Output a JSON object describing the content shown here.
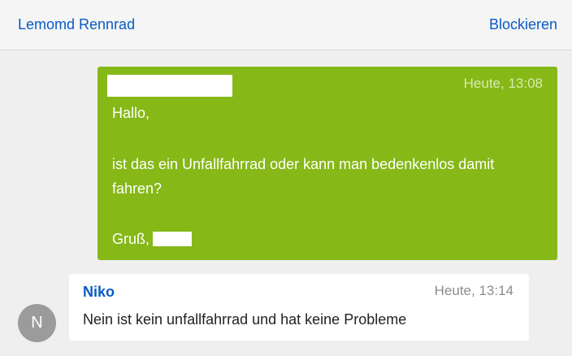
{
  "header": {
    "title": "Lemomd Rennrad",
    "block_label": "Blockieren"
  },
  "outgoing_message": {
    "timestamp": "Heute, 13:08",
    "greeting": "Hallo,",
    "body_line1": "ist das ein Unfallfahrrad oder kann man bedenkenlos damit",
    "body_line2": "fahren?",
    "signoff": "Gruß,"
  },
  "incoming_message": {
    "avatar_initial": "N",
    "sender": "Niko",
    "timestamp": "Heute, 13:14",
    "text": "Nein ist kein unfallfahrrad und hat keine Probleme"
  },
  "colors": {
    "accent_link": "#0a5bc4",
    "outgoing_bubble": "#86b817",
    "avatar": "#9b9b9b"
  }
}
